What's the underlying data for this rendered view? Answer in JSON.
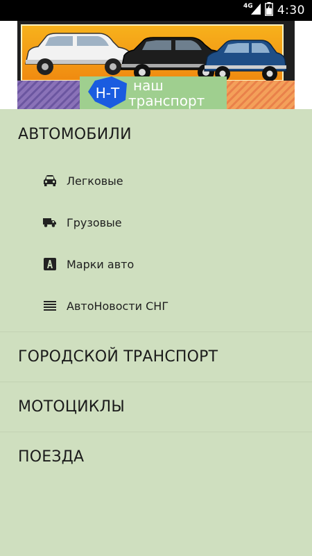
{
  "status_bar": {
    "network": "4G",
    "time": "4:30"
  },
  "banner": {
    "logo_abbrev": "Н-Т",
    "logo_line1": "наш",
    "logo_line2": "транспорт"
  },
  "menu": {
    "sections": [
      {
        "title": "АВТОМОБИЛИ",
        "items": [
          {
            "label": "Легковые",
            "icon": "car-icon"
          },
          {
            "label": "Грузовые",
            "icon": "truck-icon"
          },
          {
            "label": "Марки авто",
            "icon": "brand-a-icon"
          },
          {
            "label": "АвтоНовости СНГ",
            "icon": "list-lines-icon"
          }
        ]
      },
      {
        "title": "ГОРОДСКОЙ ТРАНСПОРТ"
      },
      {
        "title": "МОТОЦИКЛЫ"
      },
      {
        "title": "ПОЕЗДА"
      }
    ]
  },
  "colors": {
    "menu_background": "#cfdfbf",
    "status_bar": "#000000",
    "logo_blue": "#1a5ce0",
    "logo_green": "#9fcf8f"
  }
}
